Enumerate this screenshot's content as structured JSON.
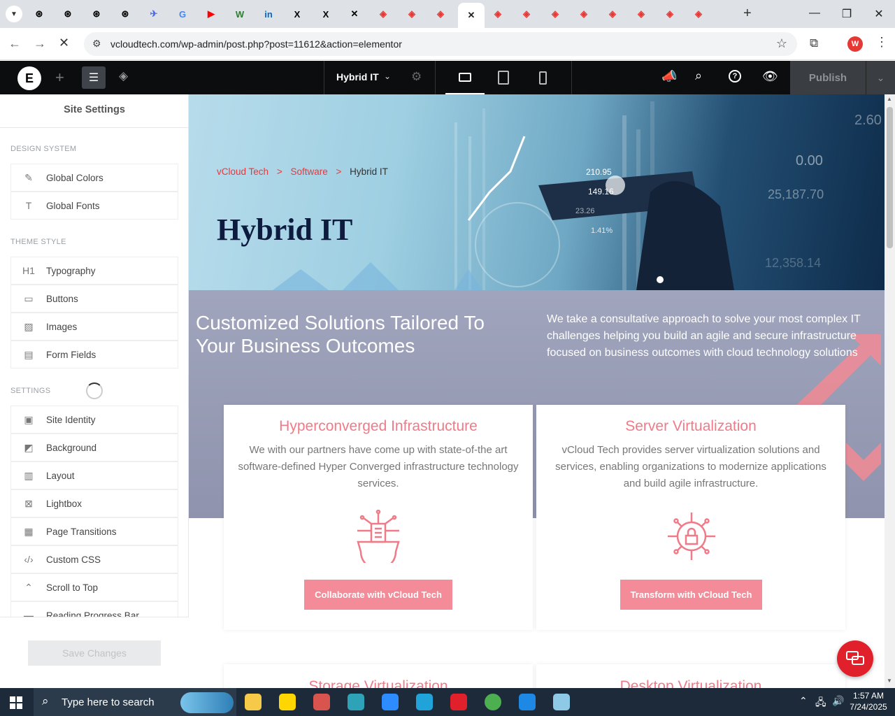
{
  "browser": {
    "tabs": [
      {
        "icon": "openai-icon",
        "color": "#000000"
      },
      {
        "icon": "openai-icon",
        "color": "#000000"
      },
      {
        "icon": "openai-icon",
        "color": "#000000"
      },
      {
        "icon": "openai-icon",
        "color": "#000000"
      },
      {
        "icon": "bird-icon",
        "color": "#4a6cf7"
      },
      {
        "icon": "google-icon",
        "color": "#4285f4"
      },
      {
        "icon": "youtube-icon",
        "color": "#ff0000"
      },
      {
        "icon": "w-icon",
        "color": "#2e7d32"
      },
      {
        "icon": "linkedin-icon",
        "color": "#0a66c2"
      },
      {
        "icon": "x-icon",
        "color": "#000000"
      },
      {
        "icon": "x-icon",
        "color": "#000000"
      },
      {
        "icon": "grok-icon",
        "color": "#000000"
      },
      {
        "icon": "elementor-red-icon",
        "color": "#e53935"
      },
      {
        "icon": "elementor-red-icon",
        "color": "#e53935"
      },
      {
        "icon": "elementor-red-icon",
        "color": "#e53935"
      },
      {
        "icon": "elementor-red-icon",
        "color": "#e53935"
      },
      {
        "icon": "elementor-red-icon",
        "color": "#e53935"
      },
      {
        "icon": "elementor-red-icon",
        "color": "#e53935"
      },
      {
        "icon": "elementor-red-icon",
        "color": "#e53935"
      },
      {
        "icon": "elementor-red-icon",
        "color": "#e53935"
      },
      {
        "icon": "elementor-red-icon",
        "color": "#e53935"
      },
      {
        "icon": "elementor-red-icon",
        "color": "#e53935"
      },
      {
        "icon": "elementor-red-icon",
        "color": "#e53935"
      }
    ],
    "active_tab_close": "✕",
    "url": "vcloudtech.com/wp-admin/post.php?post=11612&action=elementor",
    "profile_letter": "W"
  },
  "editor": {
    "page_name": "Hybrid IT",
    "publish_label": "Publish"
  },
  "sidebar": {
    "title": "Site Settings",
    "design_system_heading": "DESIGN SYSTEM",
    "design_system": [
      {
        "label": "Global Colors",
        "icon": "brush-icon"
      },
      {
        "label": "Global Fonts",
        "icon": "font-icon"
      }
    ],
    "theme_style_heading": "THEME STYLE",
    "theme_style": [
      {
        "label": "Typography",
        "icon": "h1-icon"
      },
      {
        "label": "Buttons",
        "icon": "button-icon"
      },
      {
        "label": "Images",
        "icon": "image-icon"
      },
      {
        "label": "Form Fields",
        "icon": "form-icon"
      }
    ],
    "settings_heading": "SETTINGS",
    "settings": [
      {
        "label": "Site Identity",
        "icon": "id-icon"
      },
      {
        "label": "Background",
        "icon": "background-icon"
      },
      {
        "label": "Layout",
        "icon": "layout-icon"
      },
      {
        "label": "Lightbox",
        "icon": "lightbox-icon"
      },
      {
        "label": "Page Transitions",
        "icon": "transitions-icon"
      },
      {
        "label": "Custom CSS",
        "icon": "code-icon"
      },
      {
        "label": "Scroll to Top",
        "icon": "scroll-top-icon"
      },
      {
        "label": "Reading Progress Bar",
        "icon": "progress-icon"
      }
    ],
    "save_label": "Save Changes"
  },
  "page": {
    "breadcrumb": [
      "vCloud Tech",
      ">",
      "Software",
      ">",
      "Hybrid IT"
    ],
    "hero_title": "Hybrid IT",
    "hero_numbers": [
      "210.95",
      "149.16",
      "23.26",
      "1.41%",
      "0.00",
      "25,187.70",
      "12,358.14",
      "2.60"
    ],
    "section_heading": "Customized Solutions Tailored To Your Business Outcomes",
    "section_text": "We take a consultative approach to solve your most complex IT challenges helping you build an agile and secure infrastructure focused on business outcomes with cloud technology solutions",
    "cards": [
      {
        "title": "Hyperconverged Infrastructure",
        "text": "We with our partners have come up with state-of-the art software-defined Hyper Converged infrastructure technology services.",
        "button": "Collaborate with vCloud Tech",
        "icon": "circuit-building-icon"
      },
      {
        "title": "Server Virtualization",
        "text": "vCloud Tech provides server virtualization solutions and services, enabling organizations to modernize applications and build agile infrastructure.",
        "button": "Transform with vCloud Tech",
        "icon": "circuit-lock-icon"
      },
      {
        "title": "Storage Virtualization"
      },
      {
        "title": "Desktop Virtualization"
      }
    ],
    "accent_color": "#f38b98"
  },
  "taskbar": {
    "search_placeholder": "Type here to search",
    "time": "1:57 AM",
    "date": "7/24/2025"
  }
}
